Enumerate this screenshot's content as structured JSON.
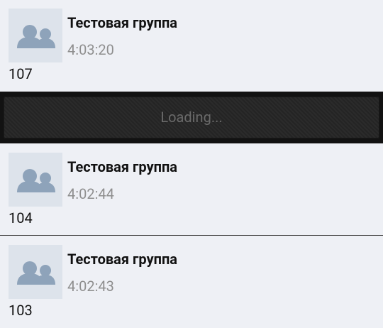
{
  "feed": {
    "posts": [
      {
        "group": "Тестовая группа",
        "time": "4:03:20",
        "text": "107"
      },
      {
        "group": "Тестовая группа",
        "time": "4:02:44",
        "text": "104"
      },
      {
        "group": "Тестовая группа",
        "time": "4:02:43",
        "text": "103"
      }
    ],
    "loading": "Loading..."
  },
  "colors": {
    "background": "#eef0f5",
    "avatar_bg": "#dde3eb",
    "avatar_figure": "#8ea3ba",
    "time_text": "#8f8f8f",
    "loading_bar": "#121212",
    "loading_text": "#6a6a6a"
  },
  "icons": {
    "avatar": "group-people-icon"
  }
}
